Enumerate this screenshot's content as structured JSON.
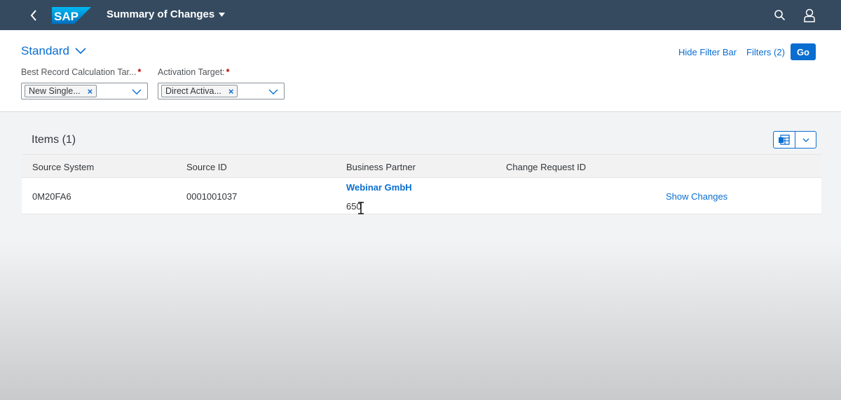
{
  "shell": {
    "title": "Summary of Changes",
    "logo_text": "SAP",
    "icons": [
      "back-icon",
      "search-icon",
      "user-icon",
      "dropdown-triangle-icon"
    ],
    "colors": {
      "shell_bg": "#354a5f",
      "accent": "#0a6ed1"
    }
  },
  "filterbar": {
    "variant": "Standard",
    "hide_filter_bar": "Hide Filter Bar",
    "filters": "Filters (2)",
    "go": "Go",
    "fields": [
      {
        "label": "Best Record Calculation Tar...",
        "required": "*",
        "token": "New Single..."
      },
      {
        "label": "Activation Target:",
        "required": "*",
        "token": "Direct Activa..."
      }
    ],
    "token_remove": "×"
  },
  "table": {
    "title": "Items (1)",
    "columns": [
      "Source System",
      "Source ID",
      "Business Partner",
      "Change Request ID"
    ],
    "rows": [
      {
        "source_system": "0M20FA6",
        "source_id": "0001001037",
        "business_partner_name": "Webinar GmbH",
        "business_partner_id": "650",
        "change_request_id": "",
        "action": "Show Changes"
      }
    ]
  }
}
